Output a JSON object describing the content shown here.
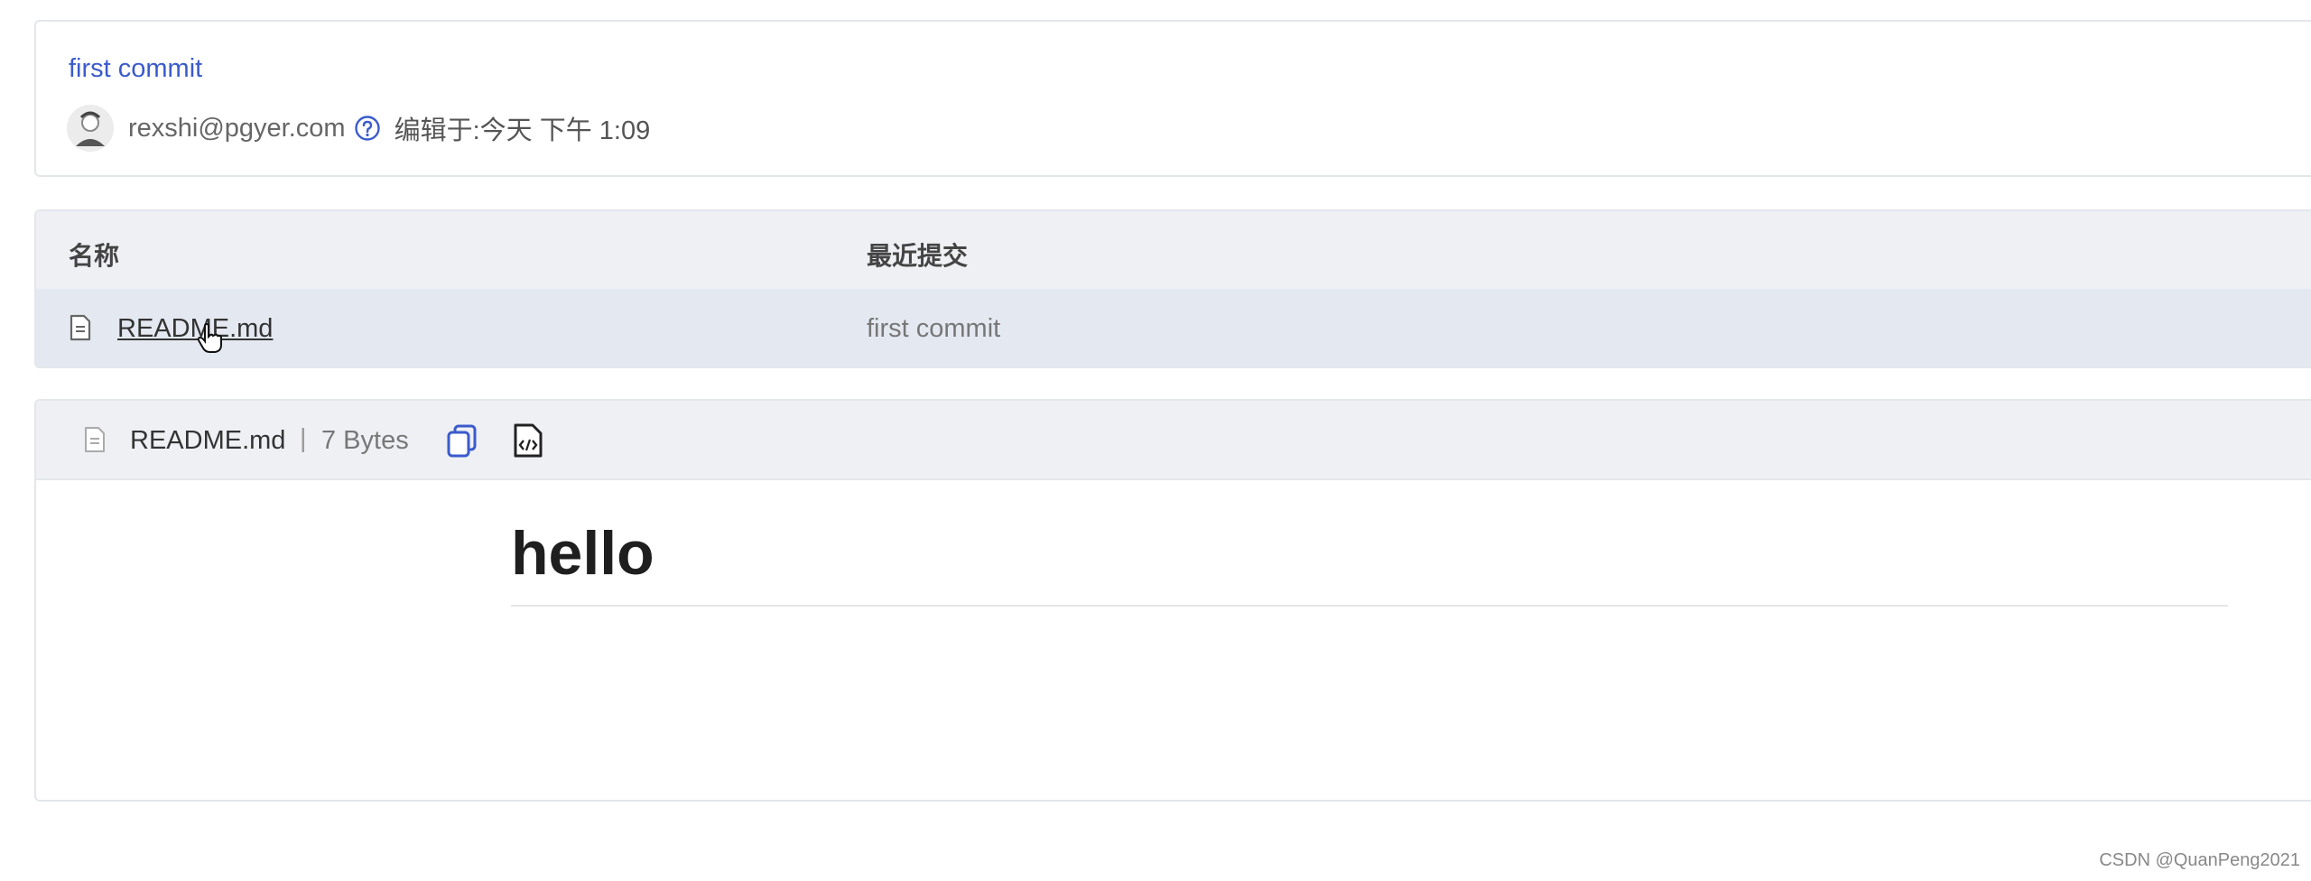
{
  "commit": {
    "title": "first commit",
    "author_email": "rexshi@pgyer.com",
    "edited_time": "编辑于:今天 下午 1:09"
  },
  "file_table": {
    "columns": [
      "名称",
      "最近提交"
    ],
    "rows": [
      {
        "name": "README.md",
        "last_commit": "first commit",
        "icon": "file-icon"
      }
    ]
  },
  "viewer": {
    "file_name": "README.md",
    "separator": "|",
    "file_size": "7 Bytes",
    "copy_icon": "copy-icon",
    "raw_icon": "code-file-icon"
  },
  "markdown": {
    "heading": "hello"
  },
  "watermark": "CSDN @QuanPeng2021",
  "colors": {
    "link": "#3b5bcc",
    "header_bg": "#eef0f4",
    "row_highlight": "#e4e9f1"
  }
}
